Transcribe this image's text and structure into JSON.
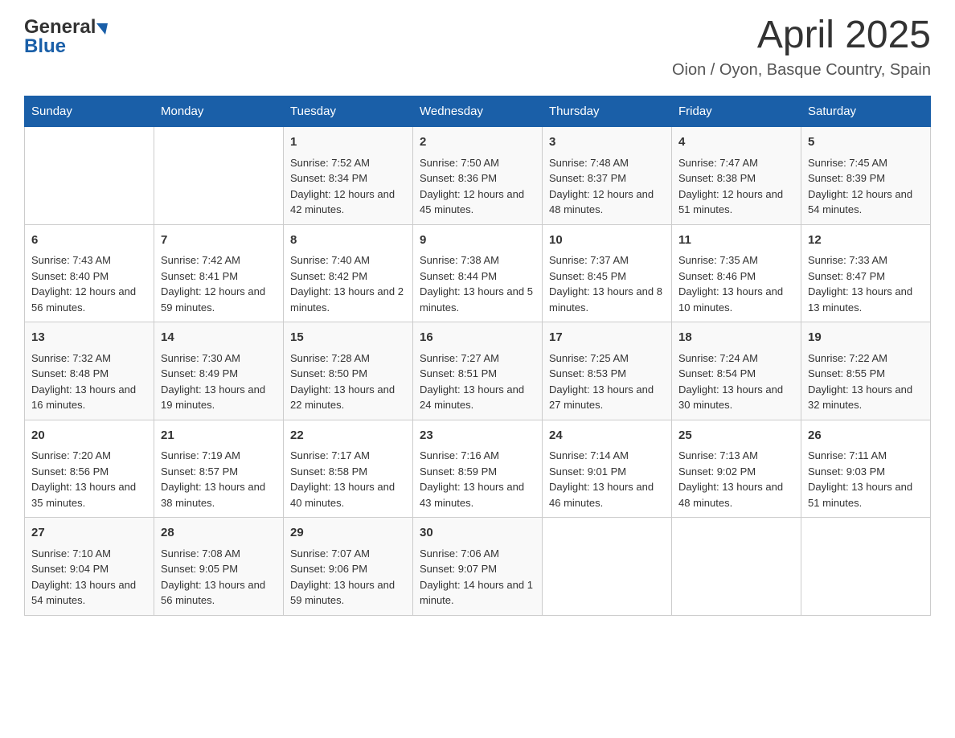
{
  "header": {
    "logo_general": "General",
    "logo_blue": "Blue",
    "title": "April 2025",
    "subtitle": "Oion / Oyon, Basque Country, Spain"
  },
  "weekdays": [
    "Sunday",
    "Monday",
    "Tuesday",
    "Wednesday",
    "Thursday",
    "Friday",
    "Saturday"
  ],
  "weeks": [
    [
      {
        "day": "",
        "sunrise": "",
        "sunset": "",
        "daylight": ""
      },
      {
        "day": "",
        "sunrise": "",
        "sunset": "",
        "daylight": ""
      },
      {
        "day": "1",
        "sunrise": "Sunrise: 7:52 AM",
        "sunset": "Sunset: 8:34 PM",
        "daylight": "Daylight: 12 hours and 42 minutes."
      },
      {
        "day": "2",
        "sunrise": "Sunrise: 7:50 AM",
        "sunset": "Sunset: 8:36 PM",
        "daylight": "Daylight: 12 hours and 45 minutes."
      },
      {
        "day": "3",
        "sunrise": "Sunrise: 7:48 AM",
        "sunset": "Sunset: 8:37 PM",
        "daylight": "Daylight: 12 hours and 48 minutes."
      },
      {
        "day": "4",
        "sunrise": "Sunrise: 7:47 AM",
        "sunset": "Sunset: 8:38 PM",
        "daylight": "Daylight: 12 hours and 51 minutes."
      },
      {
        "day": "5",
        "sunrise": "Sunrise: 7:45 AM",
        "sunset": "Sunset: 8:39 PM",
        "daylight": "Daylight: 12 hours and 54 minutes."
      }
    ],
    [
      {
        "day": "6",
        "sunrise": "Sunrise: 7:43 AM",
        "sunset": "Sunset: 8:40 PM",
        "daylight": "Daylight: 12 hours and 56 minutes."
      },
      {
        "day": "7",
        "sunrise": "Sunrise: 7:42 AM",
        "sunset": "Sunset: 8:41 PM",
        "daylight": "Daylight: 12 hours and 59 minutes."
      },
      {
        "day": "8",
        "sunrise": "Sunrise: 7:40 AM",
        "sunset": "Sunset: 8:42 PM",
        "daylight": "Daylight: 13 hours and 2 minutes."
      },
      {
        "day": "9",
        "sunrise": "Sunrise: 7:38 AM",
        "sunset": "Sunset: 8:44 PM",
        "daylight": "Daylight: 13 hours and 5 minutes."
      },
      {
        "day": "10",
        "sunrise": "Sunrise: 7:37 AM",
        "sunset": "Sunset: 8:45 PM",
        "daylight": "Daylight: 13 hours and 8 minutes."
      },
      {
        "day": "11",
        "sunrise": "Sunrise: 7:35 AM",
        "sunset": "Sunset: 8:46 PM",
        "daylight": "Daylight: 13 hours and 10 minutes."
      },
      {
        "day": "12",
        "sunrise": "Sunrise: 7:33 AM",
        "sunset": "Sunset: 8:47 PM",
        "daylight": "Daylight: 13 hours and 13 minutes."
      }
    ],
    [
      {
        "day": "13",
        "sunrise": "Sunrise: 7:32 AM",
        "sunset": "Sunset: 8:48 PM",
        "daylight": "Daylight: 13 hours and 16 minutes."
      },
      {
        "day": "14",
        "sunrise": "Sunrise: 7:30 AM",
        "sunset": "Sunset: 8:49 PM",
        "daylight": "Daylight: 13 hours and 19 minutes."
      },
      {
        "day": "15",
        "sunrise": "Sunrise: 7:28 AM",
        "sunset": "Sunset: 8:50 PM",
        "daylight": "Daylight: 13 hours and 22 minutes."
      },
      {
        "day": "16",
        "sunrise": "Sunrise: 7:27 AM",
        "sunset": "Sunset: 8:51 PM",
        "daylight": "Daylight: 13 hours and 24 minutes."
      },
      {
        "day": "17",
        "sunrise": "Sunrise: 7:25 AM",
        "sunset": "Sunset: 8:53 PM",
        "daylight": "Daylight: 13 hours and 27 minutes."
      },
      {
        "day": "18",
        "sunrise": "Sunrise: 7:24 AM",
        "sunset": "Sunset: 8:54 PM",
        "daylight": "Daylight: 13 hours and 30 minutes."
      },
      {
        "day": "19",
        "sunrise": "Sunrise: 7:22 AM",
        "sunset": "Sunset: 8:55 PM",
        "daylight": "Daylight: 13 hours and 32 minutes."
      }
    ],
    [
      {
        "day": "20",
        "sunrise": "Sunrise: 7:20 AM",
        "sunset": "Sunset: 8:56 PM",
        "daylight": "Daylight: 13 hours and 35 minutes."
      },
      {
        "day": "21",
        "sunrise": "Sunrise: 7:19 AM",
        "sunset": "Sunset: 8:57 PM",
        "daylight": "Daylight: 13 hours and 38 minutes."
      },
      {
        "day": "22",
        "sunrise": "Sunrise: 7:17 AM",
        "sunset": "Sunset: 8:58 PM",
        "daylight": "Daylight: 13 hours and 40 minutes."
      },
      {
        "day": "23",
        "sunrise": "Sunrise: 7:16 AM",
        "sunset": "Sunset: 8:59 PM",
        "daylight": "Daylight: 13 hours and 43 minutes."
      },
      {
        "day": "24",
        "sunrise": "Sunrise: 7:14 AM",
        "sunset": "Sunset: 9:01 PM",
        "daylight": "Daylight: 13 hours and 46 minutes."
      },
      {
        "day": "25",
        "sunrise": "Sunrise: 7:13 AM",
        "sunset": "Sunset: 9:02 PM",
        "daylight": "Daylight: 13 hours and 48 minutes."
      },
      {
        "day": "26",
        "sunrise": "Sunrise: 7:11 AM",
        "sunset": "Sunset: 9:03 PM",
        "daylight": "Daylight: 13 hours and 51 minutes."
      }
    ],
    [
      {
        "day": "27",
        "sunrise": "Sunrise: 7:10 AM",
        "sunset": "Sunset: 9:04 PM",
        "daylight": "Daylight: 13 hours and 54 minutes."
      },
      {
        "day": "28",
        "sunrise": "Sunrise: 7:08 AM",
        "sunset": "Sunset: 9:05 PM",
        "daylight": "Daylight: 13 hours and 56 minutes."
      },
      {
        "day": "29",
        "sunrise": "Sunrise: 7:07 AM",
        "sunset": "Sunset: 9:06 PM",
        "daylight": "Daylight: 13 hours and 59 minutes."
      },
      {
        "day": "30",
        "sunrise": "Sunrise: 7:06 AM",
        "sunset": "Sunset: 9:07 PM",
        "daylight": "Daylight: 14 hours and 1 minute."
      },
      {
        "day": "",
        "sunrise": "",
        "sunset": "",
        "daylight": ""
      },
      {
        "day": "",
        "sunrise": "",
        "sunset": "",
        "daylight": ""
      },
      {
        "day": "",
        "sunrise": "",
        "sunset": "",
        "daylight": ""
      }
    ]
  ]
}
